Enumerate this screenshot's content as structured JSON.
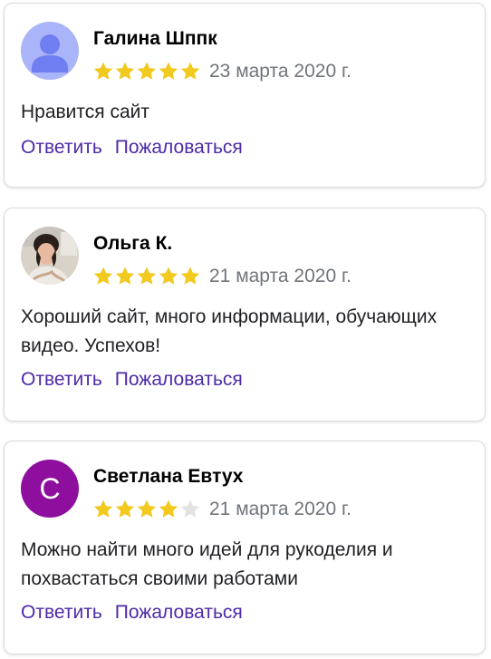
{
  "colors": {
    "star_filled": "#f2c91f",
    "star_empty": "#e3e3e3",
    "link": "#4c2aa8",
    "date": "#70757a",
    "avatar_letter_bg": "#8e0e9e",
    "avatar_default_bg": "#aab4f8"
  },
  "reviews": [
    {
      "author": "Галина Шппк",
      "avatar": "default-person-icon",
      "rating": 5,
      "date": "23 марта 2020 г.",
      "text": "Нравится сайт",
      "reply_label": "Ответить",
      "complain_label": "Пожаловаться"
    },
    {
      "author": "Ольга К.",
      "avatar": "photo",
      "rating": 5,
      "date": "21 марта 2020 г.",
      "text": "Хороший сайт, много информации, обучающих видео. Успехов!",
      "reply_label": "Ответить",
      "complain_label": "Пожаловаться"
    },
    {
      "author": "Светлана Евтух",
      "avatar": "letter",
      "avatar_letter": "С",
      "rating": 4,
      "date": "21 марта 2020 г.",
      "text": "Можно найти много идей для рукоделия и похвастаться своими работами",
      "reply_label": "Ответить",
      "complain_label": "Пожаловаться"
    }
  ]
}
